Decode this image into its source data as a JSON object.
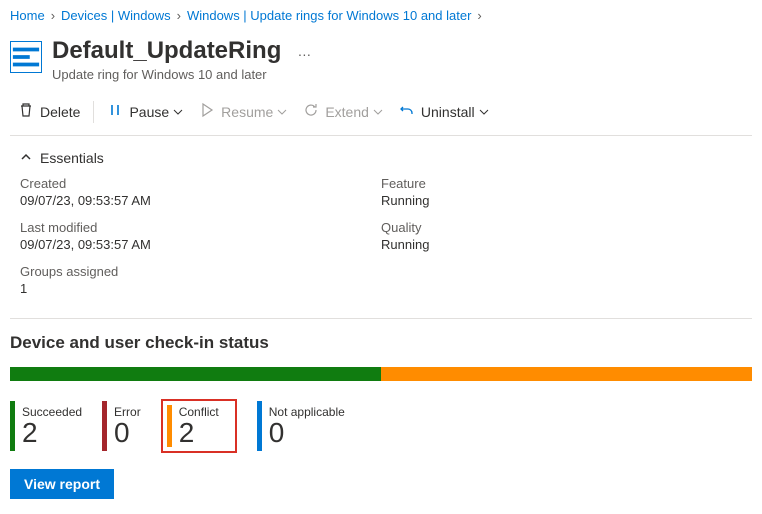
{
  "breadcrumb": [
    {
      "label": "Home"
    },
    {
      "label": "Devices | Windows"
    },
    {
      "label": "Windows | Update rings for Windows 10 and later"
    }
  ],
  "header": {
    "title": "Default_UpdateRing",
    "subtitle": "Update ring for Windows 10 and later"
  },
  "toolbar": {
    "delete": "Delete",
    "pause": "Pause",
    "resume": "Resume",
    "extend": "Extend",
    "uninstall": "Uninstall"
  },
  "essentials": {
    "title": "Essentials",
    "left": [
      {
        "label": "Created",
        "value": "09/07/23, 09:53:57 AM"
      },
      {
        "label": "Last modified",
        "value": "09/07/23, 09:53:57 AM"
      },
      {
        "label": "Groups assigned",
        "value": "1"
      }
    ],
    "right": [
      {
        "label": "Feature",
        "value": "Running"
      },
      {
        "label": "Quality",
        "value": "Running"
      }
    ]
  },
  "status": {
    "section_title": "Device and user check-in status",
    "bar": [
      {
        "color": "#107c10",
        "width": 50
      },
      {
        "color": "#ff8c00",
        "width": 50
      }
    ],
    "cards": [
      {
        "label": "Succeeded",
        "count": "2",
        "color": "#107c10",
        "highlight": false
      },
      {
        "label": "Error",
        "count": "0",
        "color": "#a4262c",
        "highlight": false
      },
      {
        "label": "Conflict",
        "count": "2",
        "color": "#ff8c00",
        "highlight": true
      },
      {
        "label": "Not applicable",
        "count": "0",
        "color": "#0078d4",
        "highlight": false
      }
    ],
    "view_report": "View report"
  }
}
